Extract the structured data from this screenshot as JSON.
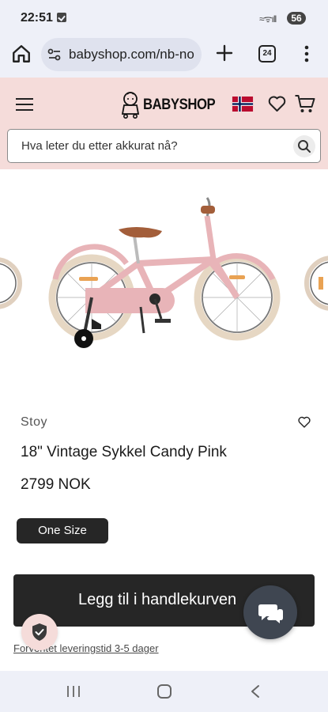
{
  "status_bar": {
    "time": "22:51",
    "signal": "≈ᯤıll",
    "battery": "56"
  },
  "browser": {
    "url": "babyshop.com/nb-no",
    "tab_count": "24"
  },
  "header": {
    "logo_text": "BABYSHOP",
    "search_placeholder": "Hva leter du etter akkurat nå?"
  },
  "product": {
    "brand": "Stoy",
    "title": "18\" Vintage Sykkel Candy Pink",
    "price": "2799 NOK",
    "size": "One Size",
    "add_to_cart": "Legg til i handlekurven",
    "delivery": "Forventet leveringstid 3-5 dager"
  },
  "colors": {
    "header_bg": "#f5dcda",
    "browser_bg": "#eef0f8",
    "button_dark": "#262626",
    "bike_pink": "#e8b4b8"
  },
  "icons": [
    "home-icon",
    "tune-icon",
    "plus-icon",
    "tabs-icon",
    "more-icon",
    "menu-icon",
    "norway-flag-icon",
    "heart-icon",
    "cart-icon",
    "search-icon",
    "shield-check-icon",
    "chat-icon",
    "recent-apps-icon",
    "nav-home-icon",
    "back-icon"
  ]
}
